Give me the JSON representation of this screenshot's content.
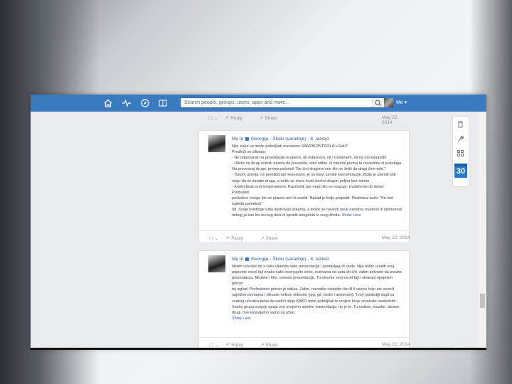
{
  "search": {
    "placeholder": "Search people, groups, users, apps and more..."
  },
  "user": {
    "name": "Me"
  },
  "feed": {
    "top_actions": {
      "reply": "Reply",
      "share": "Share",
      "date": "May 22, 2014"
    },
    "posts": [
      {
        "author": "Me to",
        "group": "Georgija - Školu (saradnje) - 8. razred",
        "paragraphs": [
          "Npr. nako se može poboljšati ovnosture SAMOKONTROLA u Edu?",
          "Predloži se izlistaju:",
          "- Ne odgovarati na provokacije ocaniem, ali ostavnom, nit i rnotaniem, nit na ino kanavštn",
          "- Ulktko Isj drugi učenik nastva da provocita, otkit odbie, ili zaturini prema ta nevenima ili pošetaga",
          "   Na provociraj druge, prema pošotuš \"Ne čini drugima one što ne želiš da drugi čine tebi.\"",
          "- Tokom učenja, ne preklidčnati nepostatni, je su ktevi zamite koncentracije. Bolje je ubeniti ivdi",
          "   nego da se zaratie druga, a ondo se mora kvati iscelni drugim poljna bez tokom",
          "- Kontrolisati svoj temperament. Razmisliti pre nego što se reaguje. Uzdahoniti do deset. Predvideti",
          "   posledice onoga što se planira reći ili uraditi. Nakad je bolje propatiti. Poslovica kaže: \"Ko ćuti",
          "   izgleda pametniji.\"",
          "Itd. Svoje predloge tuba ilustrovati slikama, a može se navesti neve narodnu mudrost ili spomenuti",
          "nekog ja kao kni tevnog dela ili spratiti anegdotu iz svog života."
        ],
        "show_link": "Show Less",
        "reply": "Reply",
        "share": "Share",
        "date": "May 22, 2014"
      },
      {
        "author": "Me to",
        "group": "Georgija - Školu (saradnje) - 8. razred",
        "paragraphs": [
          "Molim učenike da u toku vikenda rade prezentacije i postavljaju ih ovde. Nije teško uraditi svoj",
          "popunite excel fajl onako kako ocenjujete sebe, ocenama od auta do s/o, zatim počnete da pravite",
          "prezentaciju. Možete i film, umesto prezentacije. Tu otvorite svoj excel fajl i stvarani njegovim primer",
          "tej izgled. Preferiramo primer je dalica. Zatim, navodite rurediter što fil il vezicu kojo ste ocenili",
          "najnižim ocenama i dikusiie nekom slikovim (jpg, gif, može i animirani). Tvoj i posledjji slajd za",
          "svakog učenika treba da sadrži ideju KAKO biste poboljšali te vrojine kroje smatrate neelednim.",
          "Svaka grupa ocnjuje opaju svo svojemu spleten prezentaciju i to je to. Tu radiise, muzike, ukrase,",
          "drugi, ove estavijamo vama na izbor."
        ],
        "show_link": "Show Less",
        "reply": "Reply",
        "share": "Share",
        "date": "May 22, 2014"
      }
    ]
  },
  "side_widget": {
    "calendar_day": "30"
  }
}
